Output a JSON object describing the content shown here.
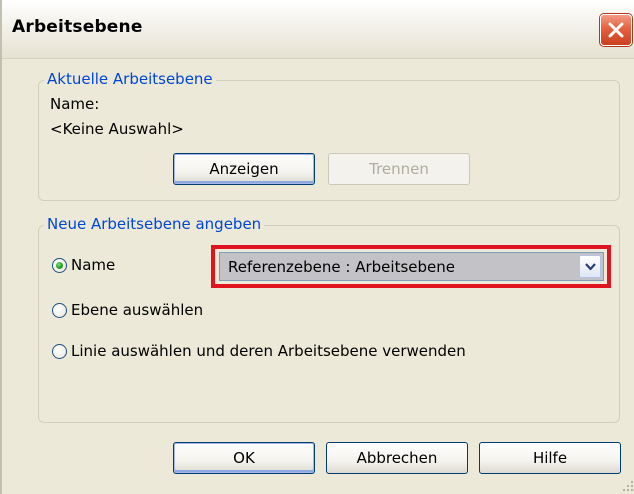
{
  "dialog": {
    "title": "Arbeitsebene",
    "close_icon": "close-x-icon"
  },
  "current_group": {
    "legend": "Aktuelle Arbeitsebene",
    "name_label": "Name:",
    "name_value": "<Keine Auswahl>",
    "show_button": "Anzeigen",
    "detach_button": "Trennen",
    "detach_enabled": false
  },
  "new_group": {
    "legend": "Neue Arbeitsebene angeben",
    "options": [
      {
        "label": "Name",
        "selected": true
      },
      {
        "label": "Ebene auswählen",
        "selected": false
      },
      {
        "label": "Linie auswählen und deren Arbeitsebene verwenden",
        "selected": false
      }
    ],
    "name_dropdown": {
      "selected": "Referenzebene : Arbeitsebene",
      "highlight_color": "#e0141e"
    }
  },
  "footer": {
    "ok_label": "OK",
    "cancel_label": "Abbrechen",
    "help_label": "Hilfe"
  },
  "colors": {
    "group_legend": "#0046d5",
    "window_bg": "#ece9d8",
    "close_button": "#e5603f"
  }
}
